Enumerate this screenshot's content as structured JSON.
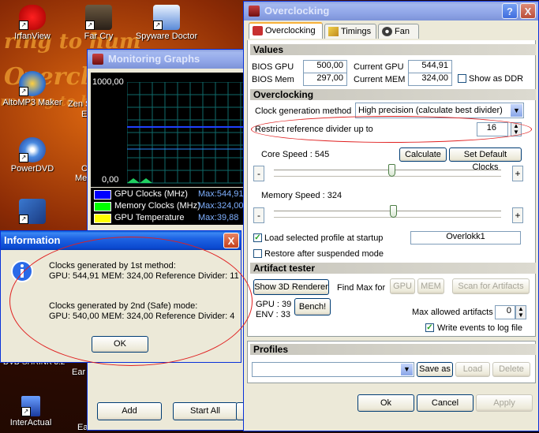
{
  "desktop": {
    "icons": [
      {
        "label": "IrfanView"
      },
      {
        "label": "Far Cry"
      },
      {
        "label": "Spyware Doctor"
      },
      {
        "label": "AltoMP3 Maker"
      },
      {
        "label": "Zen S"
      },
      {
        "label": "E"
      },
      {
        "label": "PowerDVD"
      },
      {
        "label": "C"
      },
      {
        "label": "Me"
      },
      {
        "label": "Ear"
      },
      {
        "label": "InterActual"
      },
      {
        "label": "Ea"
      }
    ],
    "bg_text": [
      "ring to hum",
      "Overclo",
      "re ring to hum"
    ]
  },
  "monitoring": {
    "title": "Monitoring Graphs",
    "y_max": "1000,00",
    "y_min": "0,00",
    "legend": [
      {
        "name": "GPU Clocks (MHz)",
        "max": "Max:544,91",
        "color": "#0000ff"
      },
      {
        "name": "Memory Clocks (MHz)",
        "max": "Max:324,00",
        "color": "#00ff00"
      },
      {
        "name": "GPU Temperature",
        "max": "Max:39,88",
        "color": "#ffff00"
      }
    ],
    "buttons": {
      "add": "Add",
      "start_all": "Start All"
    }
  },
  "info": {
    "title": "Information",
    "line1": "Clocks generated by 1st method:",
    "line2": "GPU: 544,91 MEM: 324,00 Reference Divider: 11",
    "line3": "Clocks generated by 2nd (Safe) mode:",
    "line4": "GPU: 540,00 MEM: 324,00 Reference Divider: 4",
    "ok": "OK",
    "behind_text": "DVD SHRINK 3.2"
  },
  "oc": {
    "title": "Overclocking",
    "help": "?",
    "close": "X",
    "tabs": [
      {
        "label": "Overclocking"
      },
      {
        "label": "Timings"
      },
      {
        "label": "Fan"
      }
    ],
    "values": {
      "header": "Values",
      "bios_gpu_label": "BIOS GPU",
      "bios_gpu": "500,00",
      "current_gpu_label": "Current GPU",
      "current_gpu": "544,91",
      "bios_mem_label": "BIOS Mem",
      "bios_mem": "297,00",
      "current_mem_label": "Current MEM",
      "current_mem": "324,00",
      "show_ddr": "Show as DDR"
    },
    "overclocking": {
      "header": "Overclocking",
      "clockgen_label": "Clock generation method",
      "clockgen_value": "High precision (calculate best divider)",
      "restrict_label": "Restrict reference divider up to",
      "restrict_value": "16",
      "core_speed_label": "Core Speed : 545",
      "calculate": "Calculate",
      "set_default": "Set Default Clocks",
      "core_fraction": 0.52,
      "mem_speed_label": "Memory Speed : 324",
      "mem_fraction": 0.42,
      "minus": "-",
      "plus": "+",
      "load_profile": "Load selected profile at startup",
      "profile_name": "Overlokk1",
      "restore": "Restore after suspended mode"
    },
    "artifact": {
      "header": "Artifact tester",
      "show3d": "Show 3D Renderer",
      "findmax": "Find Max for",
      "gpu": "GPU",
      "mem": "MEM",
      "scan": "Scan for Artifacts",
      "gpu_val": "GPU : 39",
      "env_val": "ENV : 33",
      "bench": "Bench!",
      "max_allowed": "Max allowed artifacts",
      "max_allowed_val": "0",
      "write_events": "Write events to log file"
    },
    "profiles": {
      "header": "Profiles",
      "save_as": "Save as",
      "load": "Load",
      "delete": "Delete"
    },
    "ok": "Ok",
    "cancel": "Cancel",
    "apply": "Apply"
  }
}
